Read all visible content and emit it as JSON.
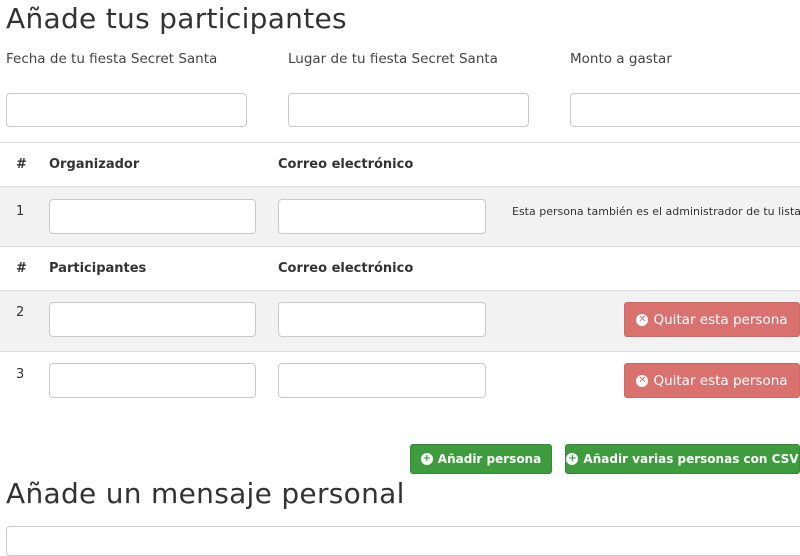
{
  "header": {
    "title": "Añade tus participantes"
  },
  "party": {
    "date_label": "Fecha de tu fiesta Secret Santa",
    "date_value": "",
    "place_label": "Lugar de tu fiesta Secret Santa",
    "place_value": "",
    "amount_label": "Monto a gastar",
    "amount_value": ""
  },
  "organizer_table": {
    "col_num": "#",
    "col_name": "Organizador",
    "col_email": "Correo electrónico",
    "row": {
      "num": "1",
      "name_value": "",
      "email_value": "",
      "note": "Esta persona también es el administrador de tu lista."
    }
  },
  "participants_table": {
    "col_num": "#",
    "col_name": "Participantes",
    "col_email": "Correo electrónico",
    "rows": [
      {
        "num": "2",
        "name_value": "",
        "email_value": "",
        "remove_label": "Quitar esta persona"
      },
      {
        "num": "3",
        "name_value": "",
        "email_value": "",
        "remove_label": "Quitar esta persona"
      }
    ]
  },
  "actions": {
    "add_person_label": "Añadir persona",
    "add_csv_label": "Añadir varias personas con CSV"
  },
  "message_section": {
    "title": "Añade un mensaje personal"
  },
  "icons": {
    "remove": "times-circle-icon",
    "add": "plus-circle-icon"
  },
  "colors": {
    "remove_button": "#d9726f",
    "add_button": "#3e9b3e",
    "row_band": "#f2f2f2"
  }
}
